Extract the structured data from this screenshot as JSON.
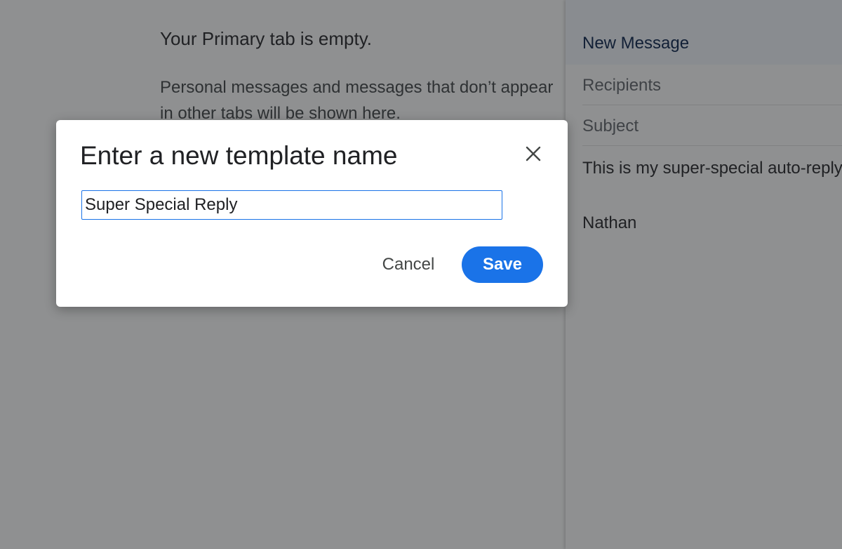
{
  "inbox": {
    "empty_title": "Your Primary tab is empty.",
    "empty_description": "Personal messages and messages that don’t appear in other tabs will be shown here."
  },
  "compose": {
    "title": "New Message",
    "recipients_placeholder": "Recipients",
    "subject_placeholder": "Subject",
    "body_text": "This is my super-special auto-reply!",
    "signature": "Nathan"
  },
  "dialog": {
    "title": "Enter a new template name",
    "input_value": "Super Special Reply",
    "cancel_label": "Cancel",
    "save_label": "Save",
    "close_icon": "close-icon"
  },
  "colors": {
    "accent": "#1a73e8",
    "scrim": "#202124"
  }
}
